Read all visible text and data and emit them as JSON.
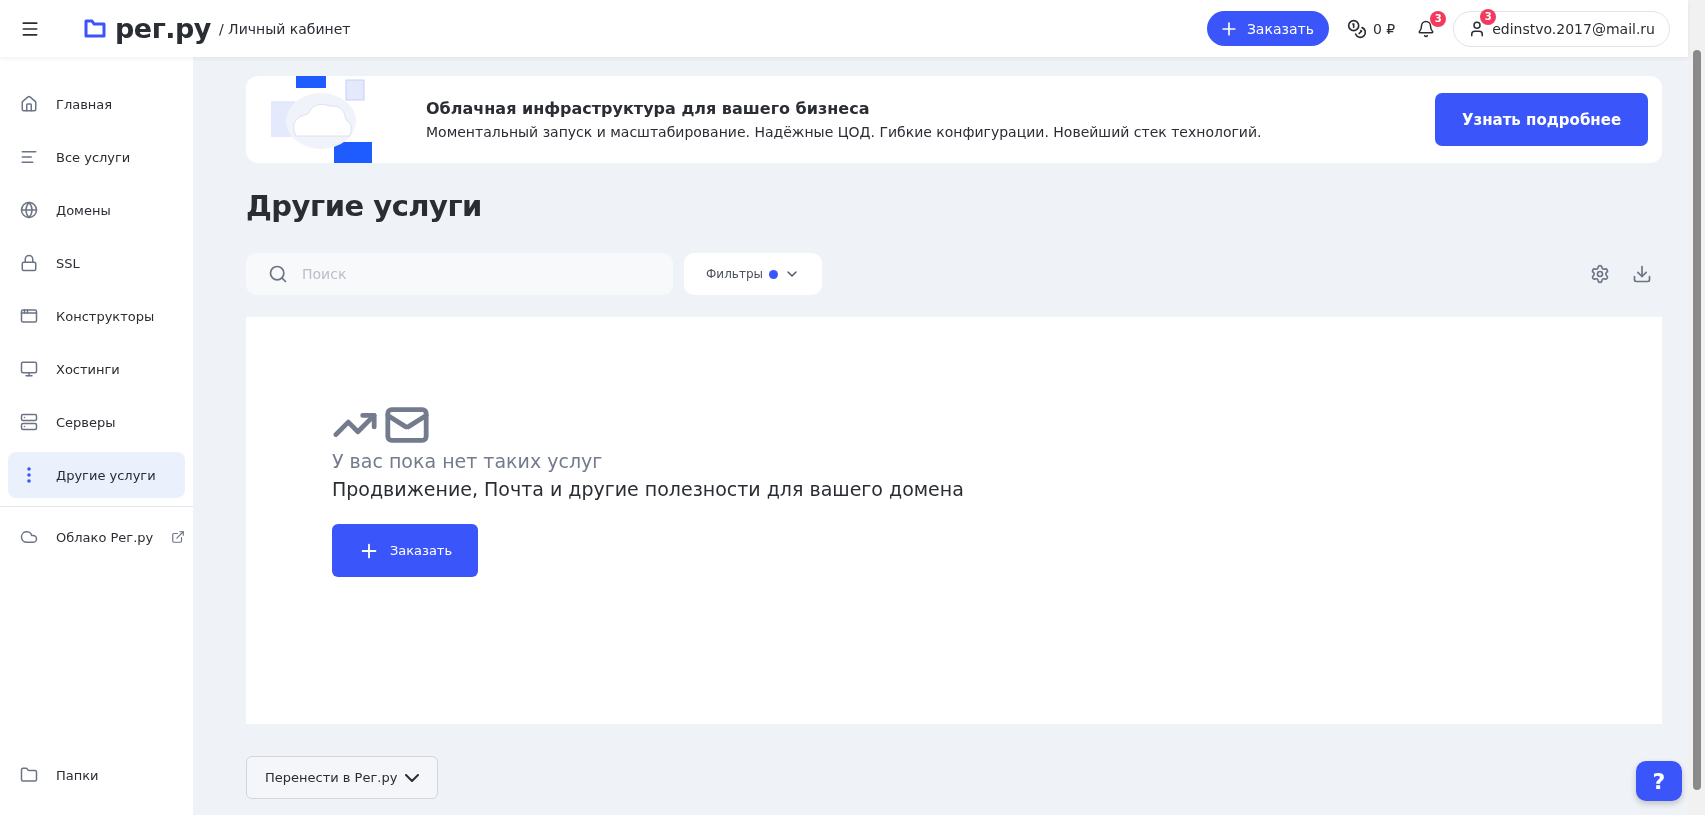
{
  "header": {
    "logo_text": "рег.ру",
    "breadcrumb": "/ Личный кабинет",
    "order_button": "Заказать",
    "balance": "0 ₽",
    "notifications_badge": "3",
    "account": {
      "email": "edinstvo.2017@mail.ru",
      "badge": "3"
    }
  },
  "sidebar": {
    "items": [
      {
        "label": "Главная",
        "selected": false
      },
      {
        "label": "Все услуги",
        "selected": false
      },
      {
        "label": "Домены",
        "selected": false
      },
      {
        "label": "SSL",
        "selected": false
      },
      {
        "label": "Конструкторы",
        "selected": false
      },
      {
        "label": "Хостинги",
        "selected": false
      },
      {
        "label": "Серверы",
        "selected": false
      },
      {
        "label": "Другие услуги",
        "selected": true
      }
    ],
    "external_link": {
      "label": "Облако Рег.ру"
    },
    "bottom_item": {
      "label": "Папки"
    }
  },
  "banner": {
    "title": "Облачная инфраструктура для вашего бизнеса",
    "text": "Моментальный запуск и масштабирование. Надёжные ЦОД. Гибкие конфигурации. Новейший стек технологий.",
    "button": "Узнать подробнее"
  },
  "page_title": "Другие услуги",
  "toolbar": {
    "search": {
      "placeholder": "Поиск"
    },
    "filters": {
      "label": "Фильтры",
      "active": true
    }
  },
  "empty_state": {
    "title": "У вас пока нет таких услуг",
    "text": "Продвижение, Почта и другие полезности для вашего домена",
    "button": "Заказать"
  },
  "transfer_button": "Перенести в Рег.ру",
  "help_button": "?"
}
